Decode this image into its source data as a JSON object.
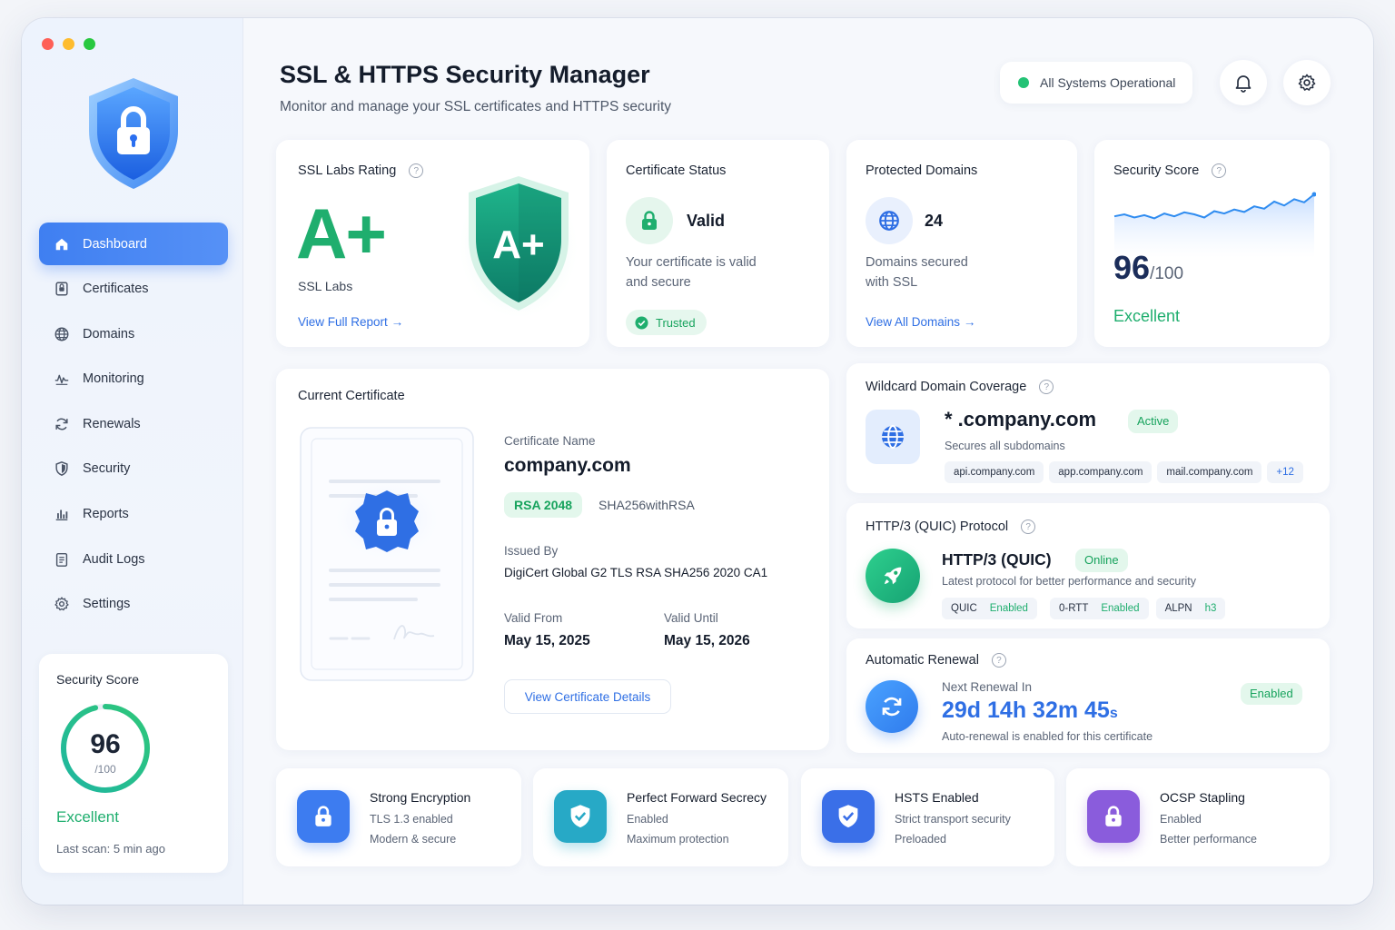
{
  "window": {
    "dot_colors": [
      "#fe5f57",
      "#febc2e",
      "#28c840"
    ]
  },
  "sidebar": {
    "items": [
      {
        "label": "Dashboard",
        "icon": "home-icon",
        "active": true
      },
      {
        "label": "Certificates",
        "icon": "certificate-icon"
      },
      {
        "label": "Domains",
        "icon": "globe-icon"
      },
      {
        "label": "Monitoring",
        "icon": "monitoring-icon"
      },
      {
        "label": "Renewals",
        "icon": "refresh-icon"
      },
      {
        "label": "Security",
        "icon": "shield-icon"
      },
      {
        "label": "Reports",
        "icon": "bar-chart-icon"
      },
      {
        "label": "Audit Logs",
        "icon": "clipboard-icon"
      },
      {
        "label": "Settings",
        "icon": "gear-icon"
      }
    ],
    "score": {
      "title": "Security Score",
      "value": "96",
      "max": "/100",
      "fraction": 0.96,
      "rating": "Excellent",
      "last_scan": "Last scan: 5 min ago"
    }
  },
  "header": {
    "title": "SSL & HTTPS Security Manager",
    "subtitle": "Monitor and manage your SSL certificates and HTTPS security",
    "status": "All Systems Operational"
  },
  "cards": {
    "ssl_rating": {
      "title": "SSL Labs Rating",
      "grade": "A+",
      "source": "SSL Labs",
      "link": "View Full Report",
      "shield_text": "A+"
    },
    "cert_status": {
      "title": "Certificate Status",
      "status": "Valid",
      "desc1": "Your certificate is valid",
      "desc2": "and secure",
      "badge": "Trusted"
    },
    "domains": {
      "title": "Protected Domains",
      "count": "24",
      "desc1": "Domains secured",
      "desc2": "with SSL",
      "link": "View All Domains"
    },
    "score": {
      "title": "Security Score",
      "value": "96",
      "max": "/100",
      "rating": "Excellent",
      "trend": [
        0.55,
        0.5,
        0.58,
        0.52,
        0.6,
        0.48,
        0.55,
        0.45,
        0.5,
        0.58,
        0.42,
        0.48,
        0.38,
        0.44,
        0.3,
        0.36,
        0.18,
        0.28,
        0.12,
        0.2,
        0.0
      ]
    }
  },
  "current_cert": {
    "title": "Current Certificate",
    "name_label": "Certificate Name",
    "name": "company.com",
    "key_badge": "RSA 2048",
    "algorithm": "SHA256withRSA",
    "issued_by_label": "Issued By",
    "issued_by": "DigiCert Global G2 TLS RSA SHA256 2020 CA1",
    "valid_from_label": "Valid From",
    "valid_from": "May 15, 2025",
    "valid_until_label": "Valid Until",
    "valid_until": "May 15, 2026",
    "button": "View Certificate Details"
  },
  "wildcard": {
    "title": "Wildcard Domain Coverage",
    "domain": "* .company.com",
    "badge": "Active",
    "desc": "Secures all subdomains",
    "chips": [
      "api.company.com",
      "app.company.com",
      "mail.company.com"
    ],
    "more": "+12"
  },
  "http3": {
    "title": "HTTP/3 (QUIC) Protocol",
    "name": "HTTP/3 (QUIC)",
    "badge": "Online",
    "desc": "Latest protocol for better performance and security",
    "chips": [
      {
        "label": "QUIC",
        "value": "Enabled"
      },
      {
        "label": "0-RTT",
        "value": "Enabled"
      },
      {
        "label": "ALPN",
        "value": "h3"
      }
    ]
  },
  "renewal": {
    "title": "Automatic Renewal",
    "label": "Next Renewal In",
    "countdown": "29d 14h 32m 45",
    "countdown_unit": "s",
    "desc": "Auto-renewal is enabled for this certificate",
    "badge": "Enabled"
  },
  "features": [
    {
      "title": "Strong Encryption",
      "line1": "TLS 1.3 enabled",
      "line2": "Modern & secure",
      "icon": "lock-icon",
      "color": "#3d7cf0"
    },
    {
      "title": "Perfect Forward Secrecy",
      "line1": "Enabled",
      "line2": "Maximum protection",
      "icon": "shield-check-icon",
      "color": "#27a9c6"
    },
    {
      "title": "HSTS Enabled",
      "line1": "Strict transport security",
      "line2": "Preloaded",
      "icon": "shield-check-icon",
      "color": "#3a6fe8"
    },
    {
      "title": "OCSP Stapling",
      "line1": "Enabled",
      "line2": "Better performance",
      "icon": "lock-icon",
      "color": "#8a5cdc"
    }
  ]
}
